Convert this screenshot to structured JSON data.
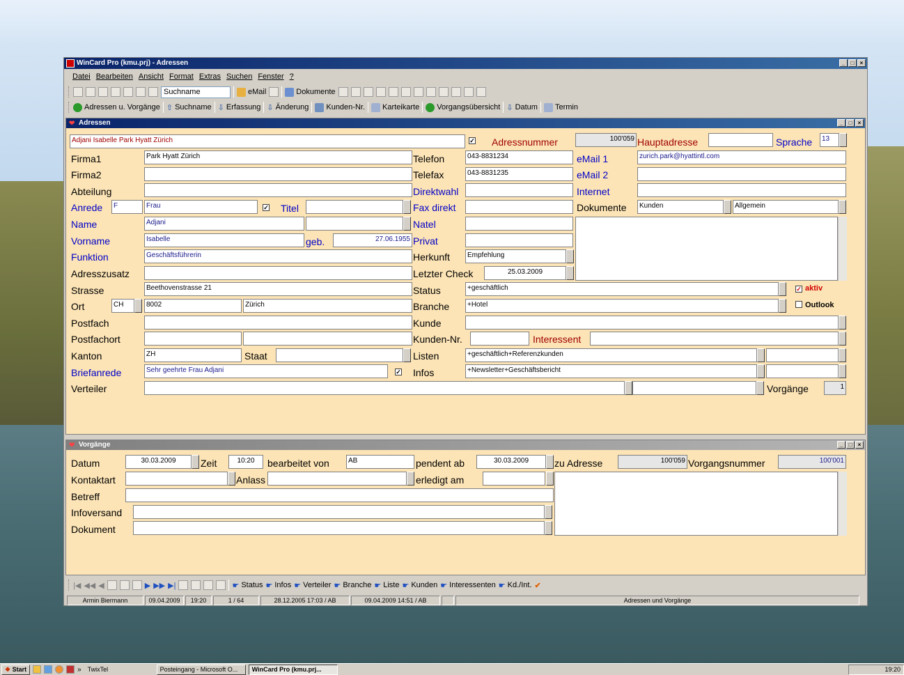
{
  "window": {
    "title": "WinCard Pro (kmu.prj) - Adressen"
  },
  "menu": [
    "Datei",
    "Bearbeiten",
    "Ansicht",
    "Format",
    "Extras",
    "Suchen",
    "Fenster",
    "?"
  ],
  "toolbar1": {
    "search_combo": "Suchname",
    "email": "eMail",
    "dokumente": "Dokumente"
  },
  "toolbar2": [
    "Adressen u. Vorgänge",
    "Suchname",
    "Erfassung",
    "Änderung",
    "Kunden-Nr.",
    "Karteikarte",
    "Vorgangsübersicht",
    "Datum",
    "Termin"
  ],
  "adressen": {
    "title": "Adressen",
    "header_name": "Adjani Isabelle Park Hyatt Zürich",
    "adressnummer_label": "Adressnummer",
    "adressnummer": "100'059",
    "hauptadresse_label": "Hauptadresse",
    "sprache_label": "Sprache",
    "sprache": "13",
    "labels": {
      "firma1": "Firma1",
      "firma2": "Firma2",
      "abteilung": "Abteilung",
      "anrede": "Anrede",
      "titel": "Titel",
      "name": "Name",
      "vorname": "Vorname",
      "geb": "geb.",
      "funktion": "Funktion",
      "adresszusatz": "Adresszusatz",
      "strasse": "Strasse",
      "ort": "Ort",
      "postfach": "Postfach",
      "postfachort": "Postfachort",
      "kanton": "Kanton",
      "staat": "Staat",
      "briefanrede": "Briefanrede",
      "verteiler": "Verteiler",
      "telefon": "Telefon",
      "telefax": "Telefax",
      "direktwahl": "Direktwahl",
      "faxdirekt": "Fax direkt",
      "natel": "Natel",
      "privat": "Privat",
      "herkunft": "Herkunft",
      "letzter_check": "Letzter Check",
      "status": "Status",
      "branche": "Branche",
      "kunde": "Kunde",
      "kunden_nr": "Kunden-Nr.",
      "interessent": "Interessent",
      "listen": "Listen",
      "infos": "Infos",
      "email1": "eMail 1",
      "email2": "eMail 2",
      "internet": "Internet",
      "dokumente": "Dokumente",
      "vorgaenge": "Vorgänge",
      "aktiv": "aktiv",
      "outlook": "Outlook"
    },
    "values": {
      "firma1": "Park Hyatt Zürich",
      "anrede_code": "F",
      "anrede": "Frau",
      "name": "Adjani",
      "vorname": "Isabelle",
      "geb": "27.06.1955",
      "funktion": "Geschäftsführerin",
      "strasse": "Beethovenstrasse 21",
      "ort_land": "CH",
      "plz": "8002",
      "ort": "Zürich",
      "kanton": "ZH",
      "briefanrede": "Sehr geehrte Frau Adjani",
      "telefon": "043-8831234",
      "telefax": "043-8831235",
      "herkunft": "Empfehlung",
      "letzter_check": "25.03.2009",
      "status": "+geschäftlich",
      "branche": "+Hotel",
      "listen": "+geschäftlich+Referenzkunden",
      "infos": "+Newsletter+Geschäftsbericht",
      "email1": "zurich.park@hyattintl.com",
      "dok1": "Kunden",
      "dok2": "Allgemein",
      "vorgaenge": "1"
    }
  },
  "vorgaenge": {
    "title": "Vorgänge",
    "labels": {
      "datum": "Datum",
      "zeit": "Zeit",
      "bearbeitet": "bearbeitet von",
      "pendent": "pendent ab",
      "zu_adresse": "zu Adresse",
      "vorgangsnummer": "Vorgangsnummer",
      "kontaktart": "Kontaktart",
      "anlass": "Anlass",
      "erledigt": "erledigt am",
      "betreff": "Betreff",
      "infoversand": "Infoversand",
      "dokument": "Dokument"
    },
    "values": {
      "datum": "30.03.2009",
      "zeit": "10:20",
      "bearbeitet": "AB",
      "pendent": "30.03.2009",
      "zu_adresse": "100'059",
      "vorgangsnummer": "100'001"
    }
  },
  "bottom_toolbar": [
    "Status",
    "Infos",
    "Verteiler",
    "Branche",
    "Liste",
    "Kunden",
    "Interessenten",
    "Kd./Int."
  ],
  "statusbar": [
    "Armin Biermann",
    "09.04.2009",
    "19:20",
    "1 / 64",
    "28.12.2005 17:03 / AB",
    "09.04.2009 14:51 / AB",
    "Adressen und Vorgänge"
  ],
  "taskbar": {
    "start": "Start",
    "items": [
      "TwixTel",
      "Posteingang - Microsoft O...",
      "WinCard Pro (kmu.prj..."
    ],
    "clock": "19:20"
  }
}
